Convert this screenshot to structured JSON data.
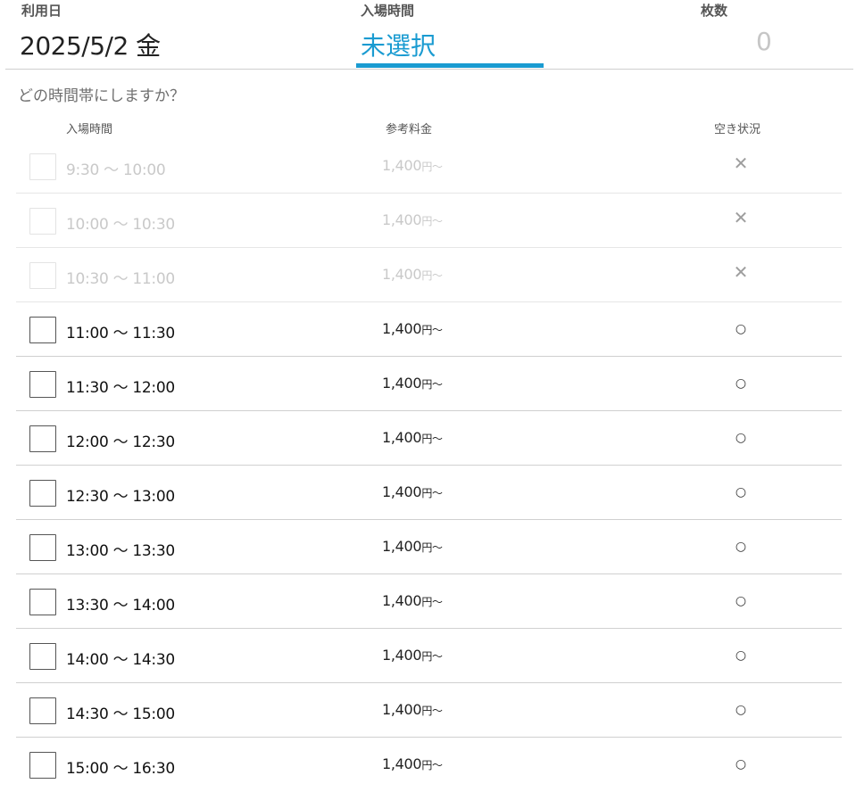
{
  "summary": {
    "date_label": "利用日",
    "date_value": "2025/5/2 金",
    "time_label": "入場時間",
    "time_value": "未選択",
    "count_label": "枚数",
    "count_value": "0"
  },
  "question": "どの時間帯にしますか？",
  "table_headers": {
    "time": "入場時間",
    "price": "参考料金",
    "availability": "空き状況"
  },
  "slots": [
    {
      "time": "9:30 ～ 10:00",
      "price": "1,400",
      "price_unit": "円～",
      "availability": "✕",
      "available": false
    },
    {
      "time": "10:00 ～ 10:30",
      "price": "1,400",
      "price_unit": "円～",
      "availability": "✕",
      "available": false
    },
    {
      "time": "10:30 ～ 11:00",
      "price": "1,400",
      "price_unit": "円～",
      "availability": "✕",
      "available": false
    },
    {
      "time": "11:00 ～ 11:30",
      "price": "1,400",
      "price_unit": "円～",
      "availability": "○",
      "available": true
    },
    {
      "time": "11:30 ～ 12:00",
      "price": "1,400",
      "price_unit": "円～",
      "availability": "○",
      "available": true
    },
    {
      "time": "12:00 ～ 12:30",
      "price": "1,400",
      "price_unit": "円～",
      "availability": "○",
      "available": true
    },
    {
      "time": "12:30 ～ 13:00",
      "price": "1,400",
      "price_unit": "円～",
      "availability": "○",
      "available": true
    },
    {
      "time": "13:00 ～ 13:30",
      "price": "1,400",
      "price_unit": "円～",
      "availability": "○",
      "available": true
    },
    {
      "time": "13:30 ～ 14:00",
      "price": "1,400",
      "price_unit": "円～",
      "availability": "○",
      "available": true
    },
    {
      "time": "14:00 ～ 14:30",
      "price": "1,400",
      "price_unit": "円～",
      "availability": "○",
      "available": true
    },
    {
      "time": "14:30 ～ 15:00",
      "price": "1,400",
      "price_unit": "円～",
      "availability": "○",
      "available": true
    },
    {
      "time": "15:00 ～ 16:30",
      "price": "1,400",
      "price_unit": "円～",
      "availability": "○",
      "available": true
    }
  ],
  "colors": {
    "accent": "#1a9bd1",
    "disabled_text": "#c9c9c9"
  }
}
